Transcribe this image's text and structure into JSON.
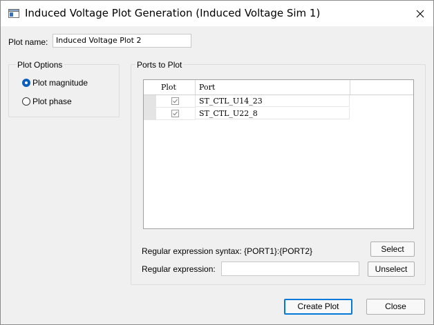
{
  "window": {
    "title": "Induced Voltage Plot Generation (Induced Voltage Sim 1)",
    "close_glyph": "✕",
    "icon": "app-window-icon"
  },
  "plot_name": {
    "label": "Plot name:",
    "value": "Induced Voltage Plot 2"
  },
  "plot_options": {
    "title": "Plot Options",
    "options": [
      {
        "label": "Plot magnitude",
        "selected": true
      },
      {
        "label": "Plot phase",
        "selected": false
      }
    ]
  },
  "ports": {
    "title": "Ports to Plot",
    "columns": [
      "Plot",
      "Port"
    ],
    "rows": [
      {
        "checked": true,
        "port": "ST_CTL_U14_23"
      },
      {
        "checked": true,
        "port": "ST_CTL_U22_8"
      }
    ],
    "regex_syntax": "Regular expression syntax: {PORT1}:{PORT2}",
    "regex_label": "Regular expression:",
    "regex_value": "",
    "select_label": "Select",
    "unselect_label": "Unselect"
  },
  "footer": {
    "create_label": "Create Plot",
    "close_label": "Close"
  },
  "colors": {
    "accent": "#0078d7",
    "radio_selected": "#0a5fbd"
  }
}
